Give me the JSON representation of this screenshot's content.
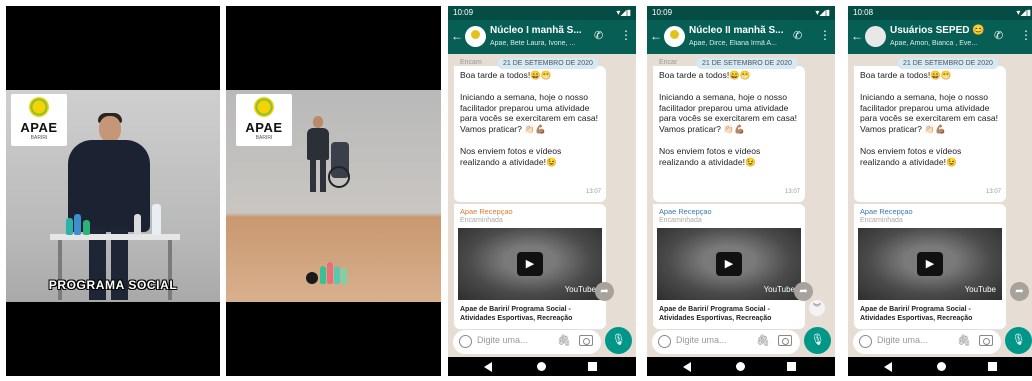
{
  "video1": {
    "logo_text": "APAE",
    "logo_sub": "BARIRI",
    "caption": "PROGRAMA SOCIAL"
  },
  "video2": {
    "logo_text": "APAE",
    "logo_sub": "BARIRI"
  },
  "chats": [
    {
      "time": "10:09",
      "title": "Núcleo I manhã S...",
      "members": "Apae, Bete Laura, Ivone, ...",
      "forwarded_ghost": "Encam",
      "date": "21 DE SETEMBRO DE 2020",
      "message": {
        "lines": [
          "Boa tarde a todos!😄😁",
          "Iniciando a semana, hoje o nosso facilitador preparou uma atividade para vocês se exercitarem em casa! Vamos praticar? 👏🏻💪🏽",
          "Nos enviem fotos e vídeos realizando a atividade!😉"
        ],
        "time": "13:07"
      },
      "media": {
        "sender": "Apae Recepçao",
        "forwarded": "Encaminhada",
        "youtube": "YouTube",
        "link_title": "Apae de Bariri/ Programa Social - Atividades Esportivas, Recreação"
      },
      "input_placeholder": "Digite uma...",
      "sender_color": "#d97b37"
    },
    {
      "time": "10:09",
      "title": "Núcleo II manhã S...",
      "members": "Apae, Dirce, Eliana Irmã A...",
      "forwarded_ghost": "Encar",
      "date": "21 DE SETEMBRO DE 2020",
      "message": {
        "lines": [
          "Boa tarde a todos!😄😁",
          "Iniciando a semana, hoje o nosso facilitador preparou uma atividade para vocês se exercitarem em casa! Vamos praticar? 👏🏻💪🏽",
          "Nos enviem fotos e vídeos realizando a atividade!😉"
        ],
        "time": "13:07"
      },
      "media": {
        "sender": "Apae Recepçao",
        "forwarded": "Encaminhada",
        "youtube": "YouTube",
        "link_title": "Apae de Bariri/ Programa Social - Atividades Esportivas, Recreação"
      },
      "input_placeholder": "Digite uma...",
      "sender_color": "#3a78b5"
    },
    {
      "time": "10:08",
      "title": "Usuários SEPED 😊",
      "members": "Apae, Amon, Bianca , Eve...",
      "forwarded_ghost": "",
      "date": "21 DE SETEMBRO DE 2020",
      "message": {
        "lines": [
          "Boa tarde a todos!😄😁",
          "Iniciando a semana, hoje o nosso facilitador preparou uma atividade para vocês se exercitarem em casa! Vamos praticar? 👏🏻💪🏽",
          "Nos enviem fotos e vídeos realizando a atividade!😉"
        ],
        "time": "13:07"
      },
      "media": {
        "sender": "Apae Recepçao",
        "forwarded": "Encaminhada",
        "youtube": "YouTube",
        "link_title": "Apae de Bariri/ Programa Social - Atividades Esportivas, Recreação"
      },
      "input_placeholder": "Digite uma...",
      "sender_color": "#3a78b5"
    }
  ],
  "icons": {
    "back": "arrow-left-icon",
    "call": "add-call-icon",
    "menu": "more-vert-icon",
    "share": "forward-icon",
    "scroll": "chevrons-down-icon",
    "emoji": "emoji-icon",
    "clip": "paperclip-icon",
    "camera": "camera-icon",
    "mic": "mic-icon"
  },
  "colors": {
    "header": "#075e54",
    "accent": "#009688",
    "chat_bg": "#e6ddd4"
  }
}
